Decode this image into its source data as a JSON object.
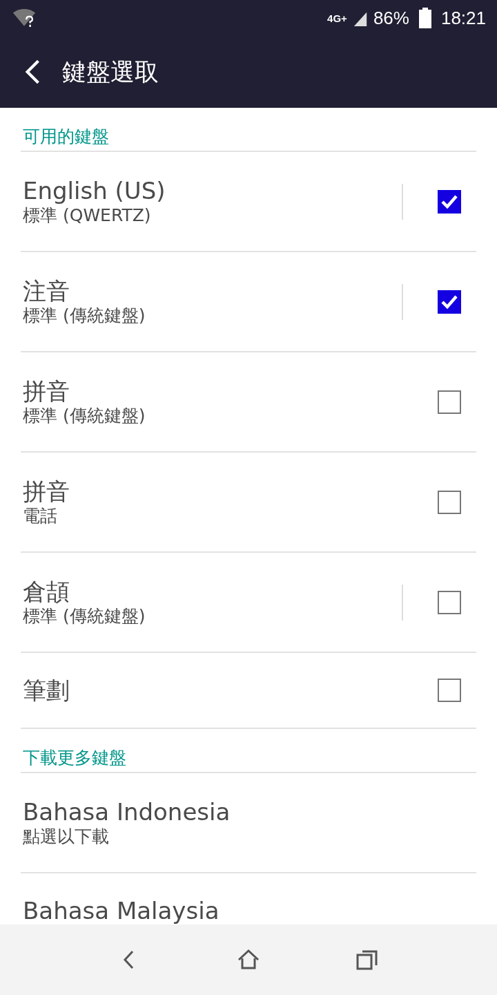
{
  "status_bar": {
    "network": "4G+",
    "battery": "86%",
    "time": "18:21"
  },
  "header": {
    "title": "鍵盤選取"
  },
  "sections": [
    {
      "title": "可用的鍵盤",
      "items": [
        {
          "kind": "checkbox",
          "title": "English (US)",
          "subtitle": "標準 (QWERTZ)",
          "checked": true,
          "has_settings": true
        },
        {
          "kind": "checkbox",
          "title": "注音",
          "subtitle": "標準 (傳統鍵盤)",
          "checked": true,
          "has_settings": true
        },
        {
          "kind": "checkbox",
          "title": "拼音",
          "subtitle": "標準 (傳統鍵盤)",
          "checked": false,
          "has_settings": false
        },
        {
          "kind": "checkbox",
          "title": "拼音",
          "subtitle": "電話",
          "checked": false,
          "has_settings": false
        },
        {
          "kind": "checkbox",
          "title": "倉頡",
          "subtitle": "標準 (傳統鍵盤)",
          "checked": false,
          "has_settings": true
        },
        {
          "kind": "checkbox",
          "title": "筆劃",
          "checked": false,
          "has_settings": false
        }
      ]
    },
    {
      "title": "下載更多鍵盤",
      "items": [
        {
          "kind": "download",
          "title": "Bahasa Indonesia",
          "subtitle": "點選以下載"
        },
        {
          "kind": "download",
          "title": "Bahasa Malaysia"
        }
      ]
    }
  ]
}
